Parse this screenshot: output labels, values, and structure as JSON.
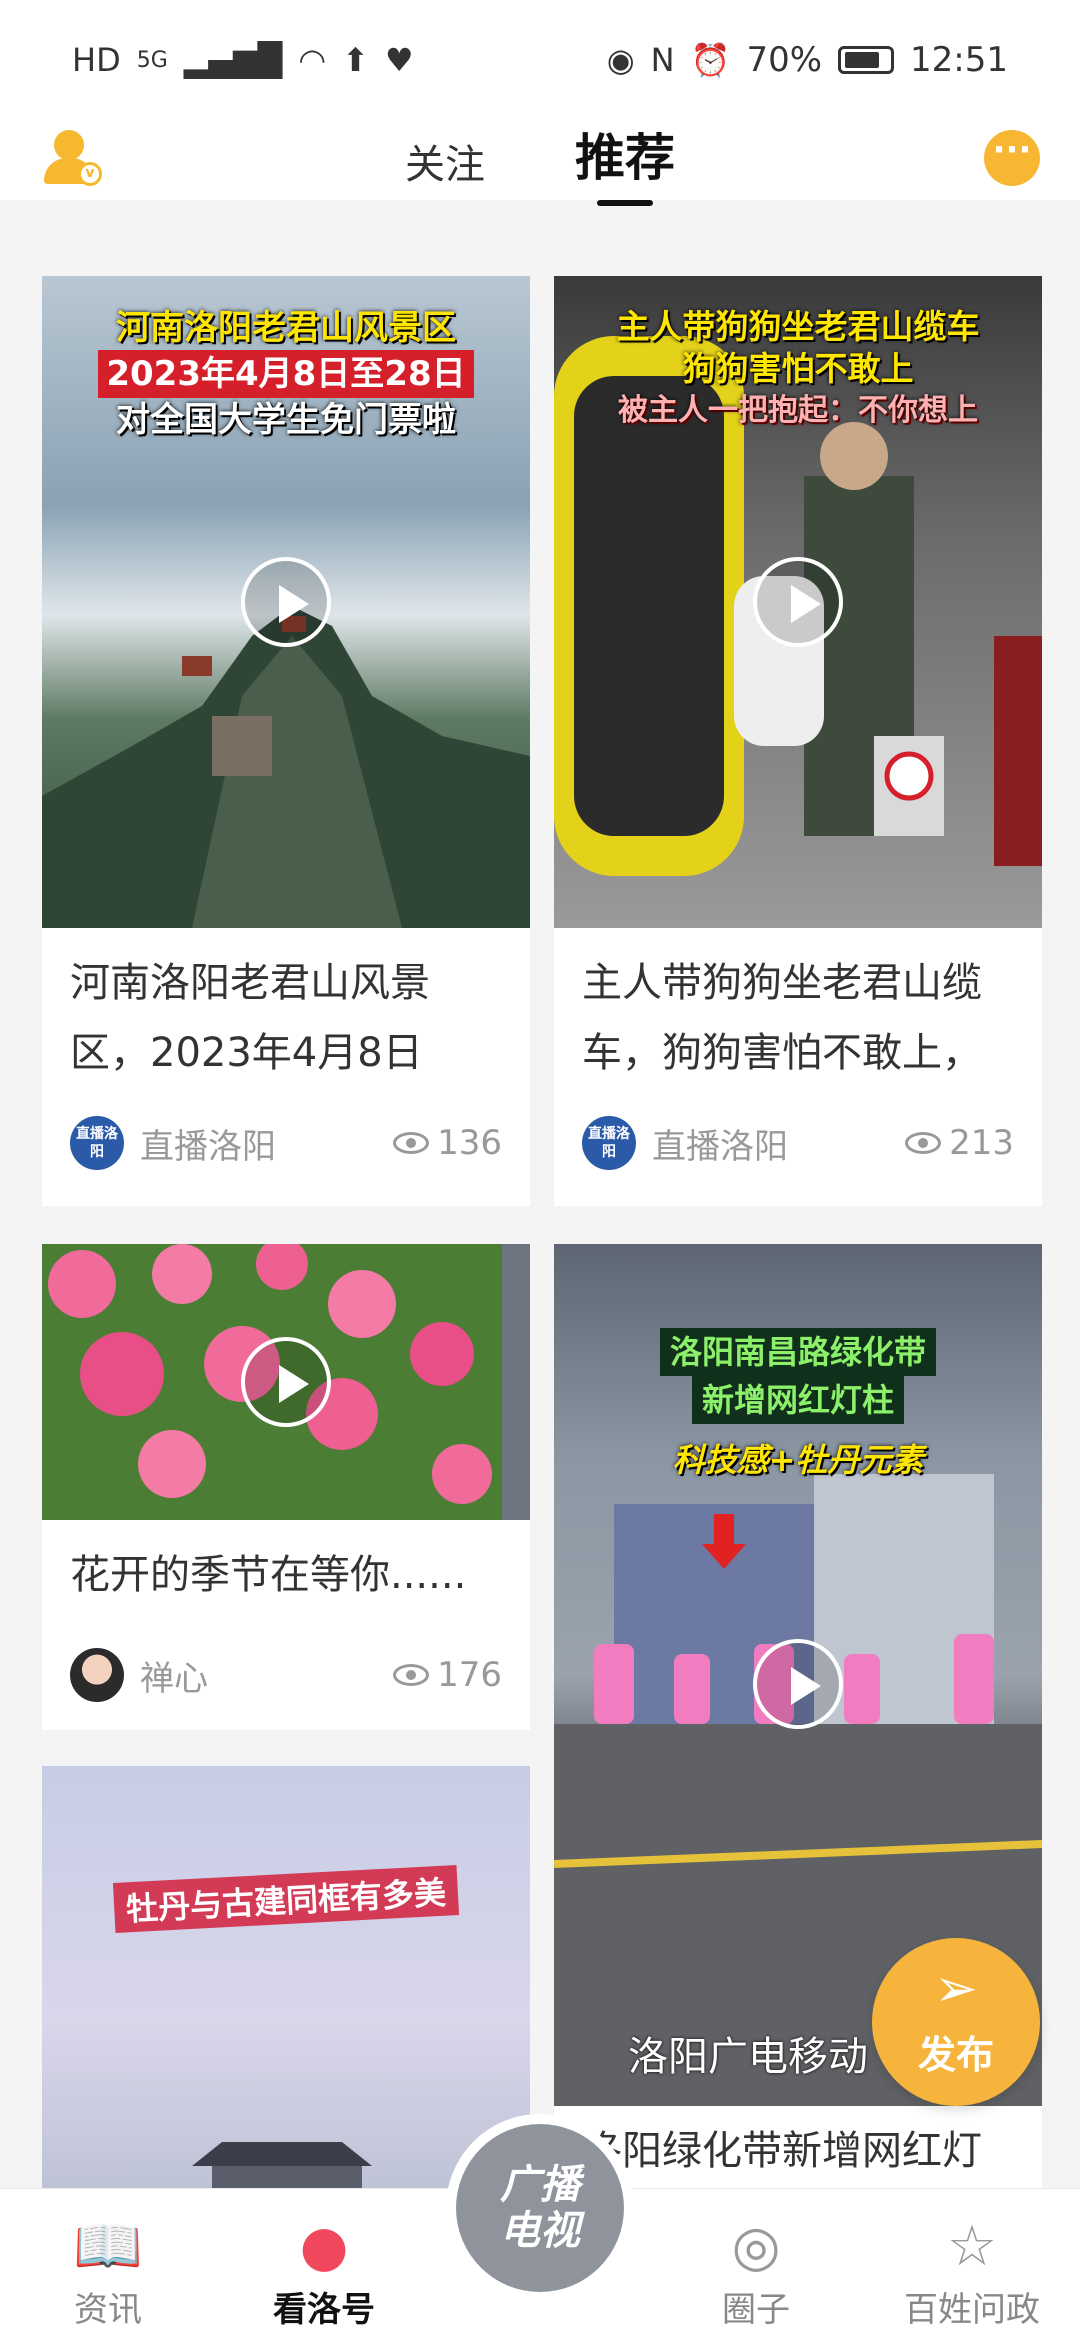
{
  "status_bar": {
    "left_icons": [
      "HD",
      "5G",
      "signal-icon",
      "wifi-icon",
      "upload-icon",
      "heart-shield-icon"
    ],
    "hd": "HD",
    "network": "5G",
    "battery": "70%",
    "time": "12:51"
  },
  "header": {
    "tabs": [
      {
        "label": "关注",
        "active": false
      },
      {
        "label": "推荐",
        "active": true
      }
    ],
    "accent_color": "#f5b82e"
  },
  "feed": {
    "items": [
      {
        "caption_lines": [
          "河南洛阳老君山风景区",
          "2023年4月8日至28日",
          "对全国大学生免门票啦"
        ],
        "title": "河南洛阳老君山风景区，2023年4月8日",
        "publisher": "直播洛阳",
        "publisher_avatar_text": "直播洛阳",
        "views": "136"
      },
      {
        "caption_lines": [
          "主人带狗狗坐老君山缆车",
          "狗狗害怕不敢上",
          "被主人一把抱起：不你想上"
        ],
        "title": "主人带狗狗坐老君山缆车，狗狗害怕不敢上，",
        "publisher": "直播洛阳",
        "publisher_avatar_text": "直播洛阳",
        "views": "213"
      },
      {
        "caption_lines": [],
        "title": "花开的季节在等你......",
        "publisher": "禅心",
        "views": "176"
      },
      {
        "caption_lines": [
          "洛阳南昌路绿化带",
          "新增网红灯柱",
          "科技感+牡丹元素"
        ],
        "bottom_caption": "洛阳广电移动",
        "title": "洛阳绿化带新增网红灯",
        "publisher": "",
        "views": ""
      },
      {
        "caption_lines": [
          "牡丹与古建同框有多美"
        ],
        "title": "",
        "publisher": "",
        "views": ""
      }
    ]
  },
  "fab": {
    "label": "发布",
    "icon": "paper-plane-icon"
  },
  "bottom_nav": {
    "items": [
      {
        "label": "资讯",
        "icon": "book-icon",
        "active": false
      },
      {
        "label": "看洛号",
        "icon": "user-icon",
        "active": true
      },
      {
        "label": "圈子",
        "icon": "spiral-icon",
        "active": false
      },
      {
        "label": "百姓问政",
        "icon": "document-star-icon",
        "active": false
      }
    ],
    "center": {
      "line1": "广播",
      "line2": "电视",
      "icon": "tv-icon"
    }
  }
}
